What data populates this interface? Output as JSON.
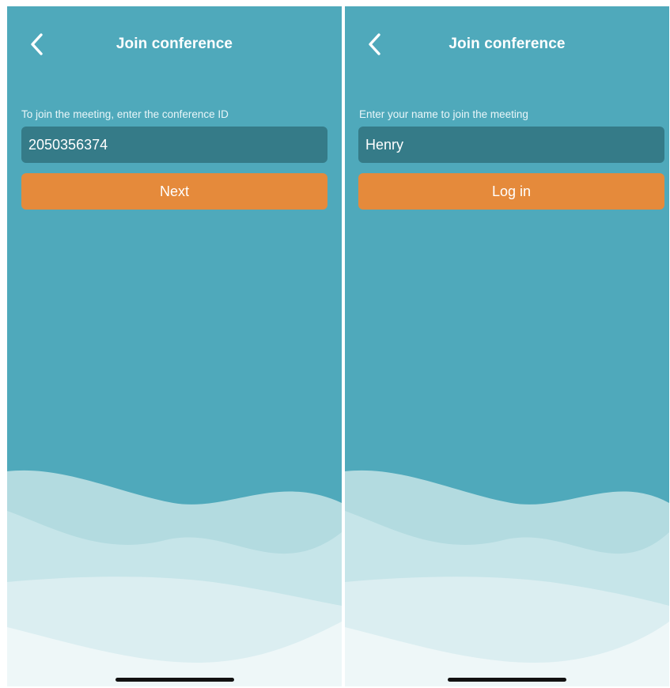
{
  "colors": {
    "background": "#4fa9bb",
    "field": "#357b88",
    "button": "#e58a3b",
    "text": "#ffffff"
  },
  "screens": [
    {
      "header": {
        "back_icon": "chevron-left-icon",
        "title": "Join conference"
      },
      "prompt": "To join the meeting, enter the conference ID",
      "field": {
        "value": "2050356374",
        "placeholder": ""
      },
      "button_label": "Next"
    },
    {
      "header": {
        "back_icon": "chevron-left-icon",
        "title": "Join conference"
      },
      "prompt": "Enter your name to join the meeting",
      "field": {
        "value": "Henry",
        "placeholder": ""
      },
      "button_label": "Log in"
    }
  ]
}
